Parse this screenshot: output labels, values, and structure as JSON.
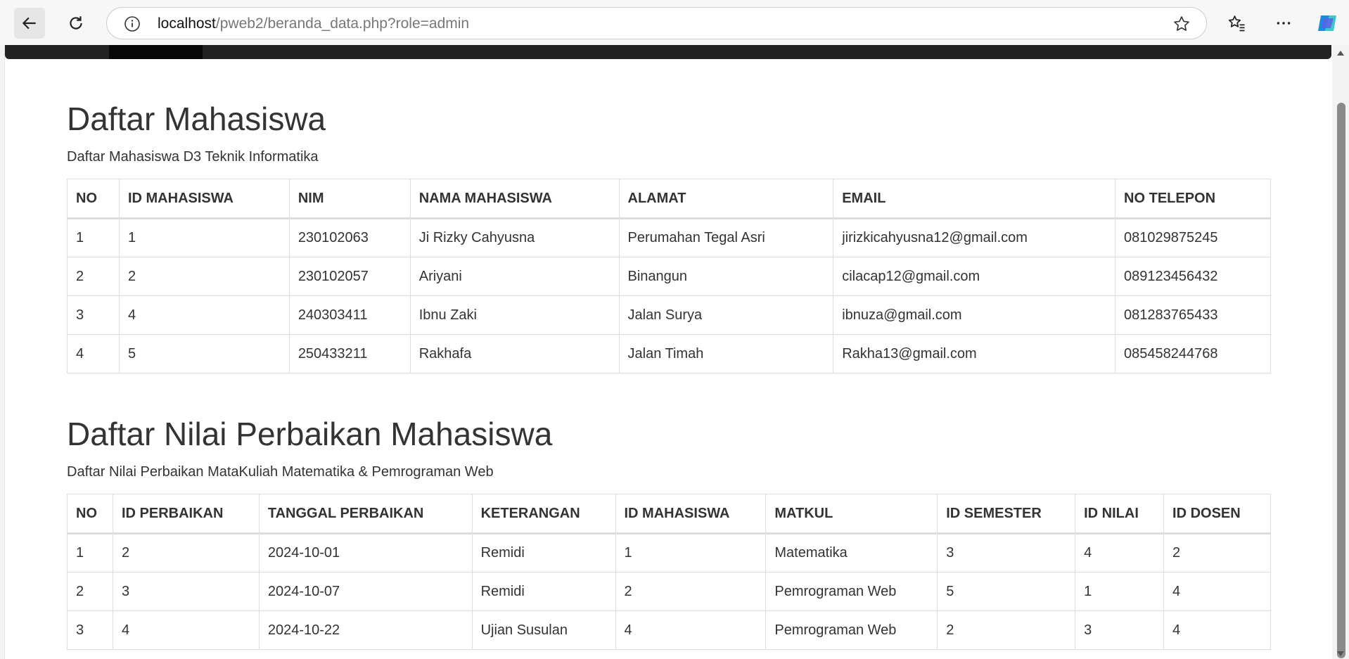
{
  "browser": {
    "url_host": "localhost",
    "url_path": "/pweb2/beranda_data.php?role=admin"
  },
  "section_mahasiswa": {
    "title": "Daftar Mahasiswa",
    "subtitle": "Daftar Mahasiswa D3 Teknik Informatika",
    "headers": [
      "NO",
      "ID MAHASISWA",
      "NIM",
      "NAMA MAHASISWA",
      "ALAMAT",
      "EMAIL",
      "NO TELEPON"
    ],
    "rows": [
      [
        "1",
        "1",
        "230102063",
        "Ji Rizky Cahyusna",
        "Perumahan Tegal Asri",
        "jirizkicahyusna12@gmail.com",
        "081029875245"
      ],
      [
        "2",
        "2",
        "230102057",
        "Ariyani",
        "Binangun",
        "cilacap12@gmail.com",
        "089123456432"
      ],
      [
        "3",
        "4",
        "240303411",
        "Ibnu Zaki",
        "Jalan Surya",
        "ibnuza@gmail.com",
        "081283765433"
      ],
      [
        "4",
        "5",
        "250433211",
        "Rakhafa",
        "Jalan Timah",
        "Rakha13@gmail.com",
        "085458244768"
      ]
    ]
  },
  "section_nilai": {
    "title": "Daftar Nilai Perbaikan Mahasiswa",
    "subtitle": "Daftar Nilai Perbaikan MataKuliah Matematika & Pemrograman Web",
    "headers": [
      "NO",
      "ID PERBAIKAN",
      "TANGGAL PERBAIKAN",
      "KETERANGAN",
      "ID MAHASISWA",
      "MATKUL",
      "ID SEMESTER",
      "ID NILAI",
      "ID DOSEN"
    ],
    "rows": [
      [
        "1",
        "2",
        "2024-10-01",
        "Remidi",
        "1",
        "Matematika",
        "3",
        "4",
        "2"
      ],
      [
        "2",
        "3",
        "2024-10-07",
        "Remidi",
        "2",
        "Pemrograman Web",
        "5",
        "1",
        "4"
      ],
      [
        "3",
        "4",
        "2024-10-22",
        "Ujian Susulan",
        "4",
        "Pemrograman Web",
        "2",
        "3",
        "4"
      ]
    ]
  }
}
